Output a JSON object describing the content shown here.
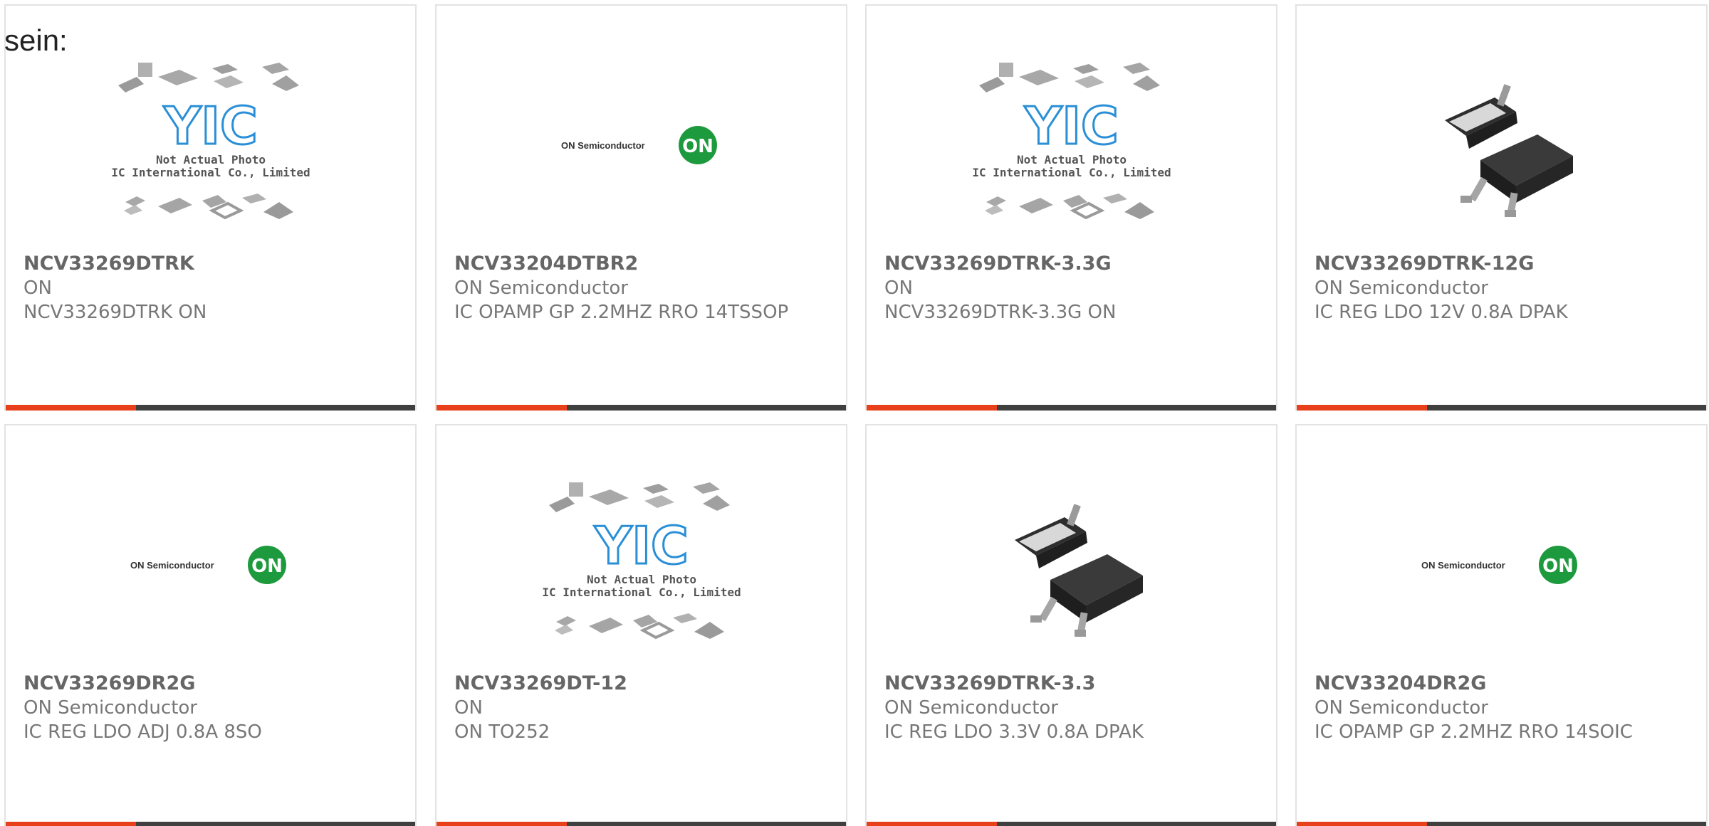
{
  "intro_text": "sein:",
  "placeholder_caption": {
    "line1": "Not Actual Photo",
    "line2": "YIC International Co., Limited.",
    "logo": "YIC"
  },
  "on_logo": {
    "wordmark": "ON Semiconductor",
    "badge": "ON"
  },
  "colors": {
    "accent": "#e8401a",
    "bar": "#3f3f3f",
    "on_green": "#1e9a3e",
    "yic_blue": "#2a8fd6"
  },
  "products": [
    {
      "part_number": "NCV33269DTRK",
      "manufacturer": "ON",
      "description": "NCV33269DTRK ON",
      "image": "yic-placeholder"
    },
    {
      "part_number": "NCV33204DTBR2",
      "manufacturer": "ON Semiconductor",
      "description": "IC OPAMP GP 2.2MHZ RRO 14TSSOP",
      "image": "on-semiconductor-logo"
    },
    {
      "part_number": "NCV33269DTRK-3.3G",
      "manufacturer": "ON",
      "description": "NCV33269DTRK-3.3G ON",
      "image": "yic-placeholder"
    },
    {
      "part_number": "NCV33269DTRK-12G",
      "manufacturer": "ON Semiconductor",
      "description": "IC REG LDO 12V 0.8A DPAK",
      "image": "dpak-package"
    },
    {
      "part_number": "NCV33269DR2G",
      "manufacturer": "ON Semiconductor",
      "description": "IC REG LDO ADJ 0.8A 8SO",
      "image": "on-semiconductor-logo"
    },
    {
      "part_number": "NCV33269DT-12",
      "manufacturer": "ON",
      "description": "ON TO252",
      "image": "yic-placeholder"
    },
    {
      "part_number": "NCV33269DTRK-3.3",
      "manufacturer": "ON Semiconductor",
      "description": "IC REG LDO 3.3V 0.8A DPAK",
      "image": "dpak-package"
    },
    {
      "part_number": "NCV33204DR2G",
      "manufacturer": "ON Semiconductor",
      "description": "IC OPAMP GP 2.2MHZ RRO 14SOIC",
      "image": "on-semiconductor-logo"
    }
  ]
}
